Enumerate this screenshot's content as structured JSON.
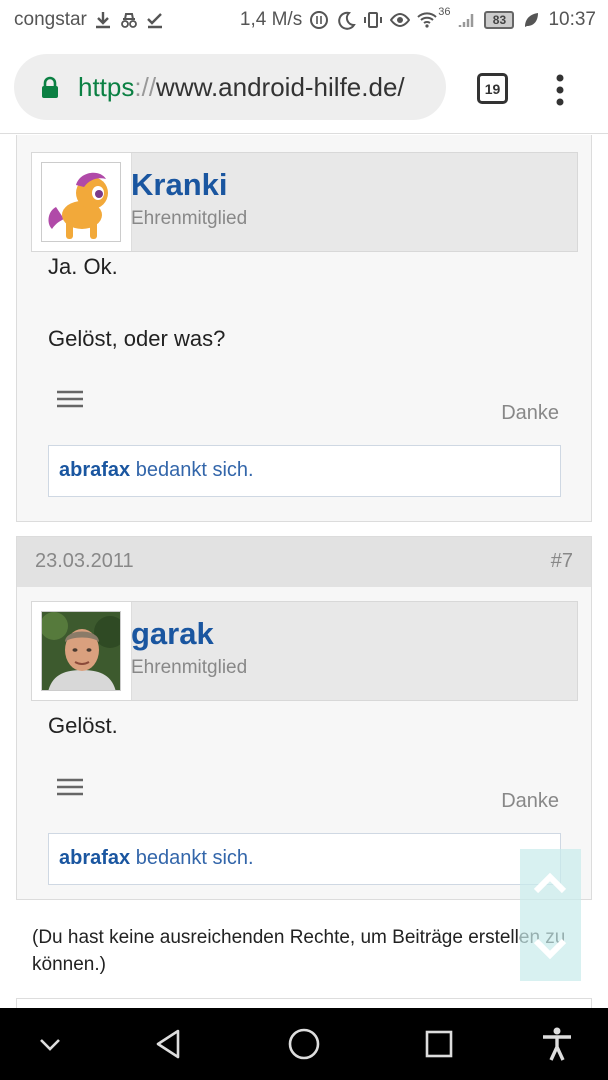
{
  "statusbar": {
    "carrier": "congstar",
    "speed": "1,4 M/s",
    "network_type": "36",
    "battery": "83",
    "time": "10:37"
  },
  "browser": {
    "url_scheme": "https",
    "url_sep": "://",
    "url_host": "www.android-hilfe.de/",
    "tab_count": "19"
  },
  "posts": [
    {
      "username": "Kranki",
      "role": "Ehrenmitglied",
      "message_lines": [
        "Ja. Ok.",
        "Gelöst, oder was?"
      ],
      "danke_label": "Danke",
      "thanks_user": "abrafax",
      "thanks_text": "bedankt sich."
    },
    {
      "date": "23.03.2011",
      "number": "#7",
      "username": "garak",
      "role": "Ehrenmitglied",
      "message_lines": [
        "Gelöst."
      ],
      "danke_label": "Danke",
      "thanks_user": "abrafax",
      "thanks_text": "bedankt sich."
    }
  ],
  "notice": "(Du hast keine ausreichenden Rechte, um Beiträge erstellen zu können.)",
  "icons": {
    "lock": "lock-icon",
    "menu": "hamburger-menu-icon",
    "scroll": "scroll-up-down-icon",
    "nav_back": "triangle-back-icon",
    "nav_home": "circle-home-icon",
    "nav_recents": "square-recents-icon",
    "nav_hide": "chevron-down-icon",
    "accessibility": "accessibility-icon"
  },
  "colors": {
    "link": "#1a56a0",
    "secure": "#0b8043",
    "meta_bg": "#e2e2e2"
  }
}
